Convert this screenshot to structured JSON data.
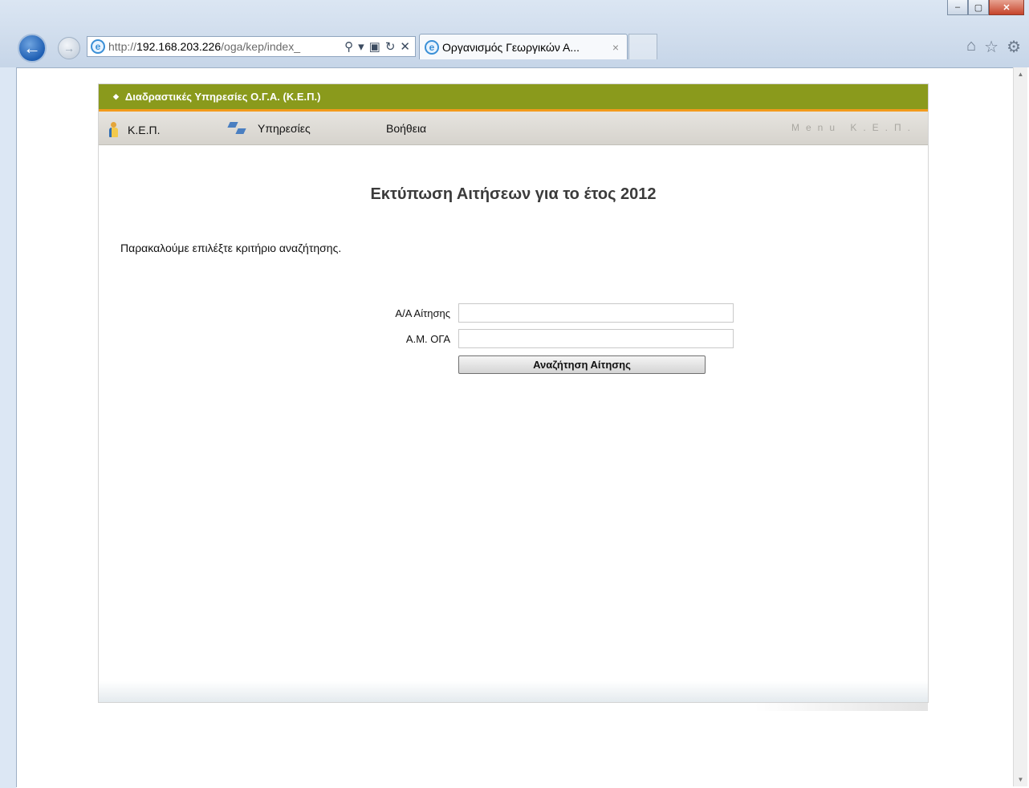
{
  "browser": {
    "address": {
      "protocol": "http://",
      "host": "192.168.203.226",
      "path": "/oga/kep/index_"
    },
    "tab": {
      "title": "Οργανισμός Γεωργικών Α...",
      "close_glyph": "×"
    }
  },
  "page": {
    "header_title": "Διαδραστικές Υπηρεσίες Ο.Γ.Α. (Κ.Ε.Π.)",
    "menu": {
      "items": [
        {
          "label": "Κ.Ε.Π.",
          "icon": "person-icon"
        },
        {
          "label": "Υπηρεσίες",
          "icon": "services-icon"
        },
        {
          "label": "Βοήθεια"
        }
      ],
      "right_caption": "Menu Κ.Ε.Π."
    },
    "title": "Εκτύπωση Αιτήσεων για το έτος 2012",
    "prompt": "Παρακαλούμε επιλέξτε κριτήριο αναζήτησης.",
    "form": {
      "application_number_label": "Α/Α Αίτησης",
      "application_number_value": "",
      "oga_registry_label": "Α.Μ. ΟΓΑ",
      "oga_registry_value": "",
      "search_button": "Αναζήτηση Αίτησης"
    }
  },
  "colors": {
    "header_green": "#8a9a1c",
    "header_orange_line": "#f39a1c",
    "menu_bg": "#dedbd5"
  }
}
